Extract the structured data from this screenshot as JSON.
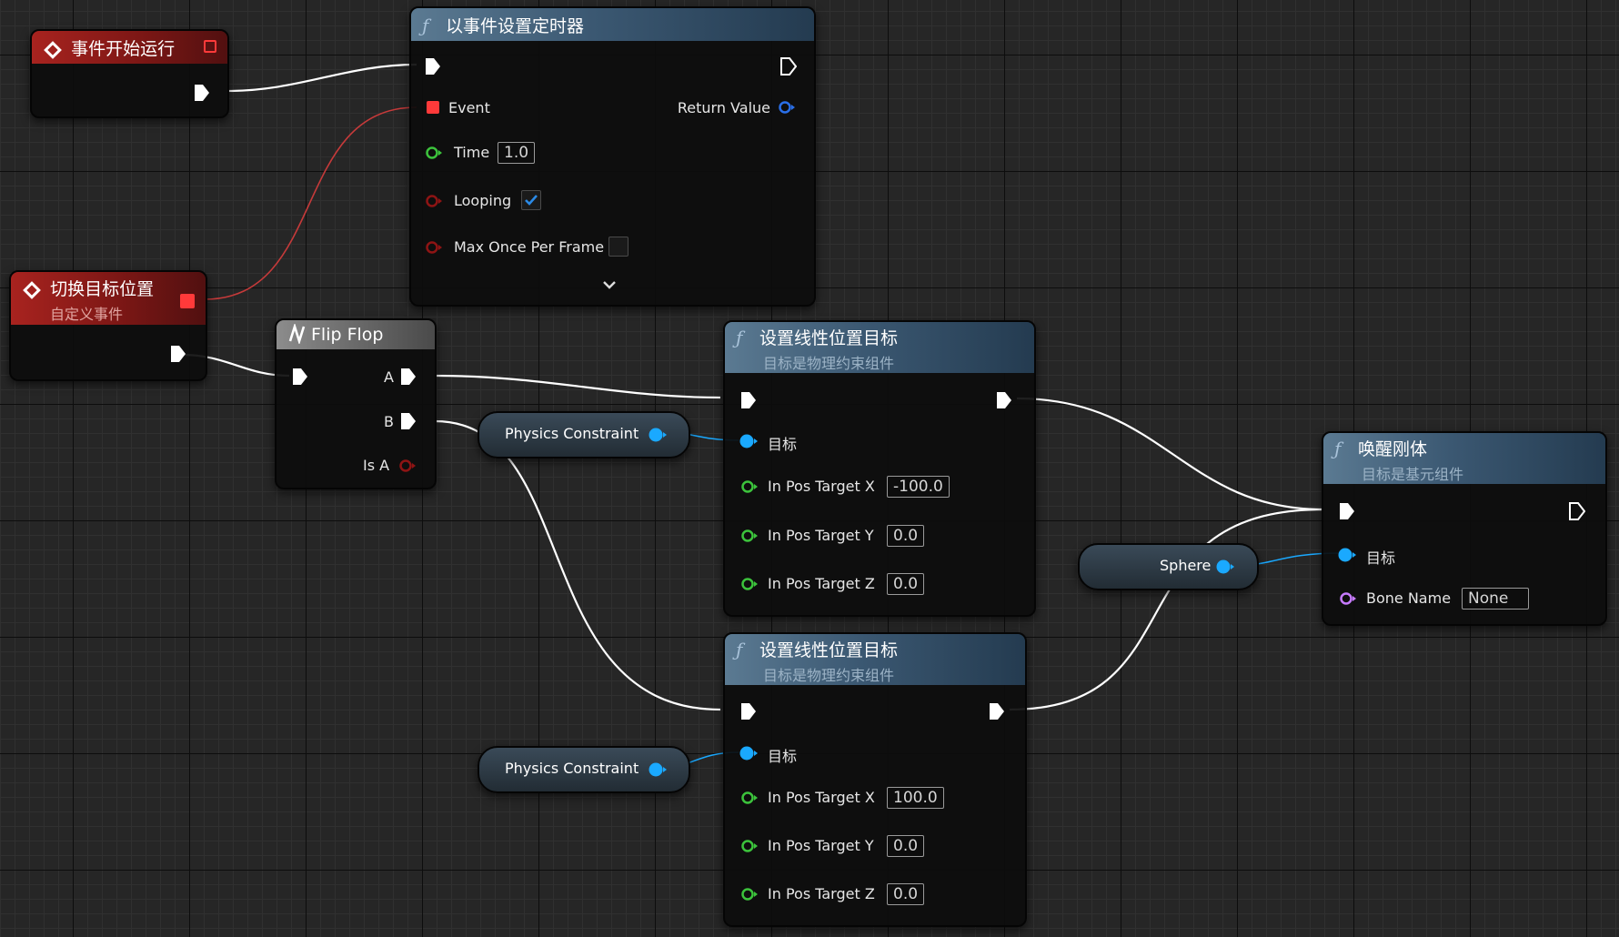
{
  "colors": {
    "exec": "#ffffff",
    "float": "#3cc33c",
    "bool": "#8e1414",
    "object": "#1aa9ff",
    "name": "#c77bff",
    "handle": "#2a6fe8",
    "delegate": "#ff3a3a",
    "delegate_wire": "#c63a3a"
  },
  "nodes": {
    "begin_play": {
      "title": "事件开始运行"
    },
    "set_timer": {
      "title": "以事件设置定时器",
      "event_label": "Event",
      "return_label": "Return Value",
      "time_label": "Time",
      "time_value": "1.0",
      "looping_label": "Looping",
      "looping_checked": true,
      "max_once_label": "Max Once Per Frame",
      "max_once_checked": false
    },
    "custom_event": {
      "title": "切换目标位置",
      "subtitle": "自定义事件"
    },
    "flip_flop": {
      "title": "Flip Flop",
      "a_label": "A",
      "b_label": "B",
      "is_a_label": "Is A"
    },
    "set_linear_1": {
      "title": "设置线性位置目标",
      "subtitle": "目标是物理约束组件",
      "target_label": "目标",
      "x_label": "In Pos Target X",
      "x_value": "-100.0",
      "y_label": "In Pos Target Y",
      "y_value": "0.0",
      "z_label": "In Pos Target Z",
      "z_value": "0.0"
    },
    "set_linear_2": {
      "title": "设置线性位置目标",
      "subtitle": "目标是物理约束组件",
      "target_label": "目标",
      "x_label": "In Pos Target X",
      "x_value": "100.0",
      "y_label": "In Pos Target Y",
      "y_value": "0.0",
      "z_label": "In Pos Target Z",
      "z_value": "0.0"
    },
    "wake_rigid": {
      "title": "唤醒刚体",
      "subtitle": "目标是基元组件",
      "target_label": "目标",
      "bone_label": "Bone Name",
      "bone_value": "None"
    },
    "physics_constraint_1": {
      "label": "Physics Constraint"
    },
    "physics_constraint_2": {
      "label": "Physics Constraint"
    },
    "sphere": {
      "label": "Sphere"
    }
  },
  "icons": {
    "function": "function-f-icon",
    "event": "event-diamond-icon",
    "flip_flop": "flip-flop-icon",
    "expand": "chevron-down-icon",
    "check": "checkmark-icon"
  }
}
